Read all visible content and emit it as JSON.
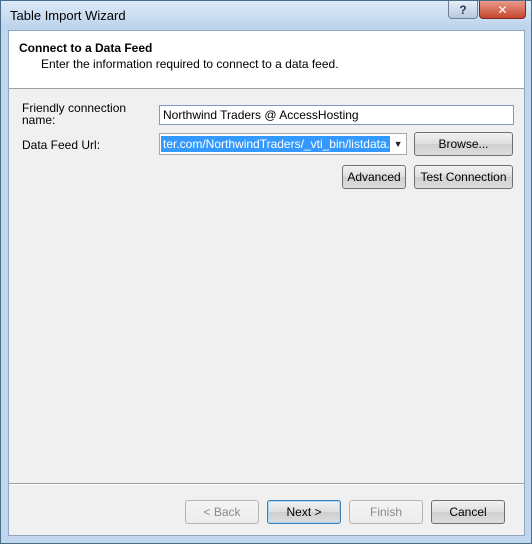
{
  "window": {
    "title": "Table Import Wizard",
    "help_label": "?",
    "close_label": "✕"
  },
  "header": {
    "title": "Connect to a Data Feed",
    "subtitle": "Enter the information required to connect to a data feed."
  },
  "form": {
    "friendly_name_label": "Friendly connection name:",
    "friendly_name_value": "Northwind Traders @ AccessHosting",
    "url_label": "Data Feed Url:",
    "url_value": "ter.com/NorthwindTraders/_vti_bin/listdata.svc",
    "browse_label": "Browse...",
    "advanced_label": "Advanced",
    "test_connection_label": "Test Connection"
  },
  "footer": {
    "back_label": "< Back",
    "next_label": "Next >",
    "finish_label": "Finish",
    "cancel_label": "Cancel"
  }
}
